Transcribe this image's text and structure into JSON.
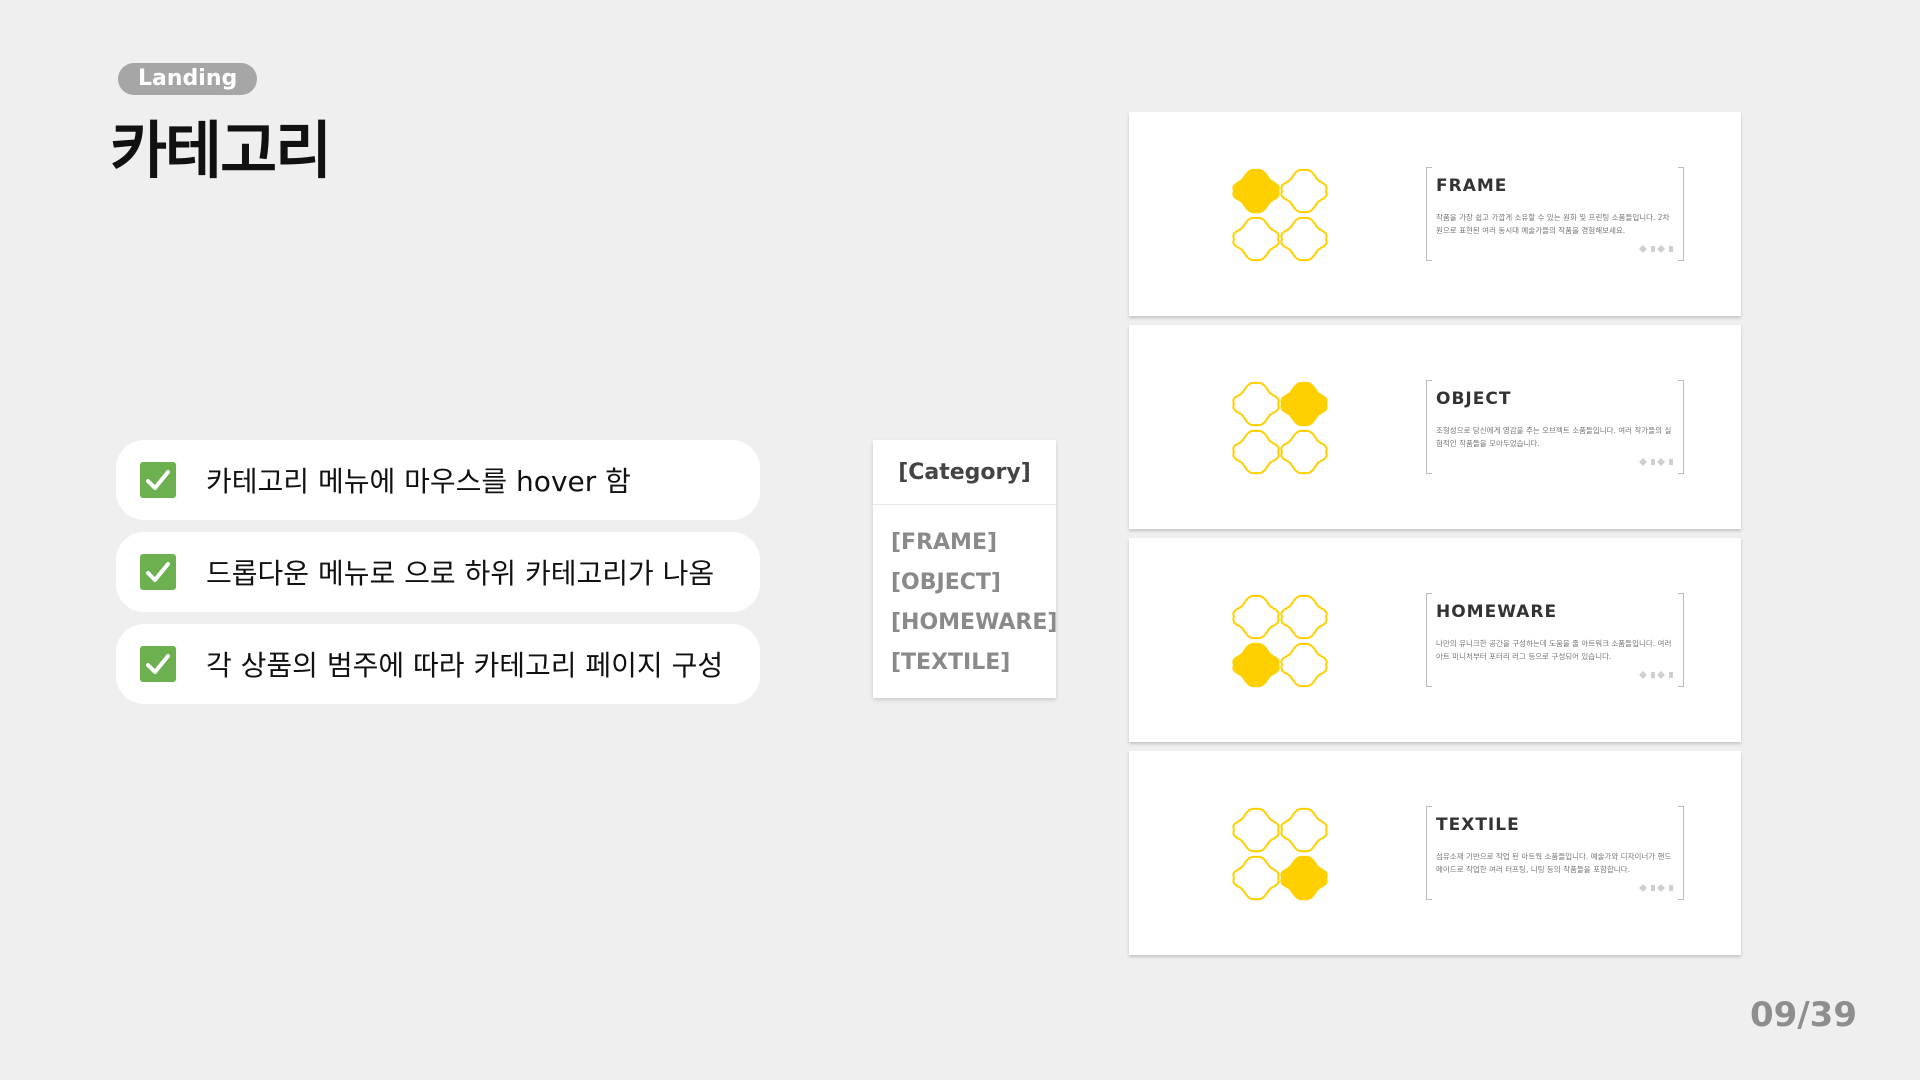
{
  "header": {
    "tag": "Landing",
    "title": "카테고리"
  },
  "checklist": [
    {
      "text": "카테고리 메뉴에 마우스를 hover 함",
      "checked": true
    },
    {
      "text": "드롭다운 메뉴로 으로 하위 카테고리가 나옴",
      "checked": true
    },
    {
      "text": "각 상품의 범주에 따라 카테고리 페이지 구성",
      "checked": true
    }
  ],
  "dropdown": {
    "heading": "[Category]",
    "items": [
      "[FRAME]",
      "[OBJECT]",
      "[HOMEWARE]",
      "[TEXTILE]"
    ]
  },
  "cards": [
    {
      "title": "FRAME",
      "desc": "작품을 가장 쉽고 가깝게 소유할 수 있는 원화 및 프린팅 소품들입니다. 2차원으로 표현된 여러 동시대 예술가들의 작품을 경험해보세요.",
      "filled_petal": "top-left"
    },
    {
      "title": "OBJECT",
      "desc": "조형성으로 당신에게 영감을 주는 오브젝트 소품들입니다. 여러 작가들의 실험적인 작품들을 모아두었습니다.",
      "filled_petal": "top-right"
    },
    {
      "title": "HOMEWARE",
      "desc": "나만의 유니크한 공간을 구성하는데 도움을 줄 아트워크 소품들입니다. 여러 아트 미니처부터 포터리 러그 등으로 구성되어 있습니다.",
      "filled_petal": "bottom-left"
    },
    {
      "title": "TEXTILE",
      "desc": "섬유소재 기반으로 작업 된 아트웍 소품들입니다. 예술가와 디자이너가 핸드메이드로 작업한 여러 터프팅, 니팅 등의 작품들을 포함합니다.",
      "filled_petal": "bottom-right"
    }
  ],
  "colors": {
    "background": "#efefef",
    "accent_yellow": "#ffd000",
    "check_green": "#6cb04f",
    "tag_gray": "#a6a6a6"
  },
  "footer": {
    "page": "09/39"
  }
}
